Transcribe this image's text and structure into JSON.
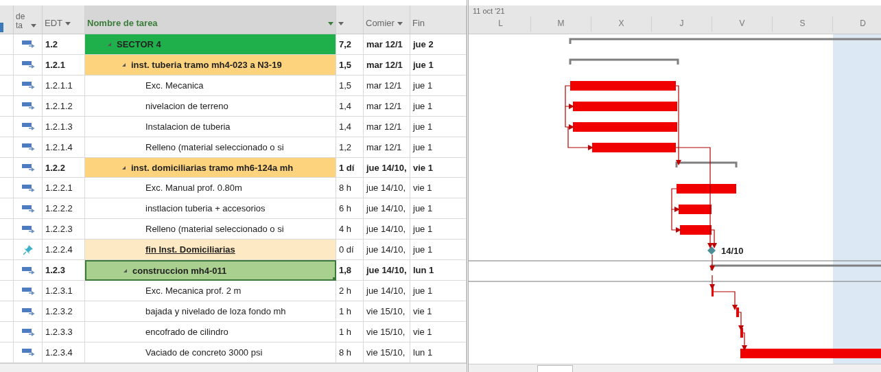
{
  "table": {
    "columns": [
      {
        "label": "de ta",
        "filter": true,
        "selected": false
      },
      {
        "label": "EDT",
        "filter": true,
        "selected": false
      },
      {
        "label": "Nombre de tarea",
        "filter": true,
        "selected": true
      },
      {
        "filter": true,
        "selected": false
      },
      {
        "label": "Comier",
        "filter": true,
        "selected": false
      },
      {
        "label": "Fin",
        "filter": false,
        "selected": false
      }
    ],
    "tasks": [
      {
        "manual": false,
        "kind": "summary",
        "edt": "1.2",
        "name": "SECTOR 4",
        "duration": "7,2",
        "start": "mar 12/1",
        "finish": "jue 2",
        "expanded": true,
        "selected": false,
        "color": "#20b04b",
        "children": [
          {
            "manual": false,
            "kind": "summary",
            "edt": "1.2.1",
            "name": "inst. tuberia tramo mh4-023 a N3-19",
            "duration": "1,5",
            "start": "mar 12/1",
            "finish": "jue 1",
            "expanded": true,
            "selected": false,
            "color": "#fdd37d",
            "children": [
              {
                "manual": false,
                "kind": "task",
                "edt": "1.2.1.1",
                "name": "Exc. Mecanica",
                "duration": "1,5",
                "start": "mar 12/1",
                "finish": "jue 1",
                "selected": false
              },
              {
                "manual": false,
                "kind": "task",
                "edt": "1.2.1.2",
                "name": "nivelacion de terreno",
                "duration": "1,4",
                "start": "mar 12/1",
                "finish": "jue 1",
                "selected": false
              },
              {
                "manual": false,
                "kind": "task",
                "edt": "1.2.1.3",
                "name": "Instalacion de tuberia",
                "duration": "1,4",
                "start": "mar 12/1",
                "finish": "jue 1",
                "selected": false
              },
              {
                "manual": false,
                "kind": "task",
                "edt": "1.2.1.4",
                "name": "Relleno (material seleccionado o si",
                "duration": "1,2",
                "start": "mar 12/1",
                "finish": "jue 1",
                "selected": false
              }
            ]
          },
          {
            "manual": false,
            "kind": "summary",
            "edt": "1.2.2",
            "name": "inst. domiciliarias tramo mh6-124a mh",
            "duration": "1 dí",
            "start": "jue 14/10,",
            "finish": "vie 1",
            "expanded": true,
            "selected": false,
            "color": "#fdd37d",
            "children": [
              {
                "manual": false,
                "kind": "task",
                "edt": "1.2.2.1",
                "name": "Exc. Manual prof. 0.80m",
                "duration": "8 h",
                "start": "jue 14/10,",
                "finish": "vie 1",
                "selected": false
              },
              {
                "manual": false,
                "kind": "task",
                "edt": "1.2.2.2",
                "name": "instlacion tuberia + accesorios",
                "duration": "6 h",
                "start": "jue 14/10,",
                "finish": "jue 1",
                "selected": false
              },
              {
                "manual": false,
                "kind": "task",
                "edt": "1.2.2.3",
                "name": "Relleno (material seleccionado o si",
                "duration": "4 h",
                "start": "jue 14/10,",
                "finish": "jue 1",
                "selected": false
              },
              {
                "manual": true,
                "kind": "milestone",
                "edt": "1.2.2.4",
                "name": "fin Inst. Domiciliarias",
                "duration": "0 dí",
                "start": "jue 14/10,",
                "finish": "jue 1",
                "selected": false,
                "color": "#fde9c3"
              }
            ]
          },
          {
            "manual": false,
            "kind": "summary",
            "edt": "1.2.3",
            "name": "construccion mh4-011",
            "duration": "1,8",
            "start": "jue 14/10,",
            "finish": "lun 1",
            "expanded": true,
            "selected": true,
            "color": "#a9d08e",
            "children": [
              {
                "manual": false,
                "kind": "task",
                "edt": "1.2.3.1",
                "name": "Exc. Mecanica prof. 2 m",
                "duration": "2 h",
                "start": "jue 14/10,",
                "finish": "jue 1",
                "selected": false
              },
              {
                "manual": false,
                "kind": "task",
                "edt": "1.2.3.2",
                "name": "bajada y nivelado de loza fondo mh",
                "duration": "1 h",
                "start": "vie 15/10,",
                "finish": "vie 1",
                "selected": false
              },
              {
                "manual": false,
                "kind": "task",
                "edt": "1.2.3.3",
                "name": "encofrado de cilindro",
                "duration": "1 h",
                "start": "vie 15/10,",
                "finish": "vie 1",
                "selected": false
              },
              {
                "manual": false,
                "kind": "task",
                "edt": "1.2.3.4",
                "name": "Vaciado de concreto 3000 psi",
                "duration": "8 h",
                "start": "vie 15/10,",
                "finish": "lun 1",
                "selected": false
              }
            ]
          }
        ]
      }
    ]
  },
  "gantt": {
    "week": "11 oct '21",
    "days": [
      {
        "label": "L",
        "nonworking": false
      },
      {
        "label": "M",
        "nonworking": false
      },
      {
        "label": "X",
        "nonworking": false
      },
      {
        "label": "J",
        "nonworking": false
      },
      {
        "label": "V",
        "nonworking": false
      },
      {
        "label": "S",
        "nonworking": false
      },
      {
        "label": "D",
        "nonworking": true
      }
    ],
    "milestone_label": "14/10"
  }
}
